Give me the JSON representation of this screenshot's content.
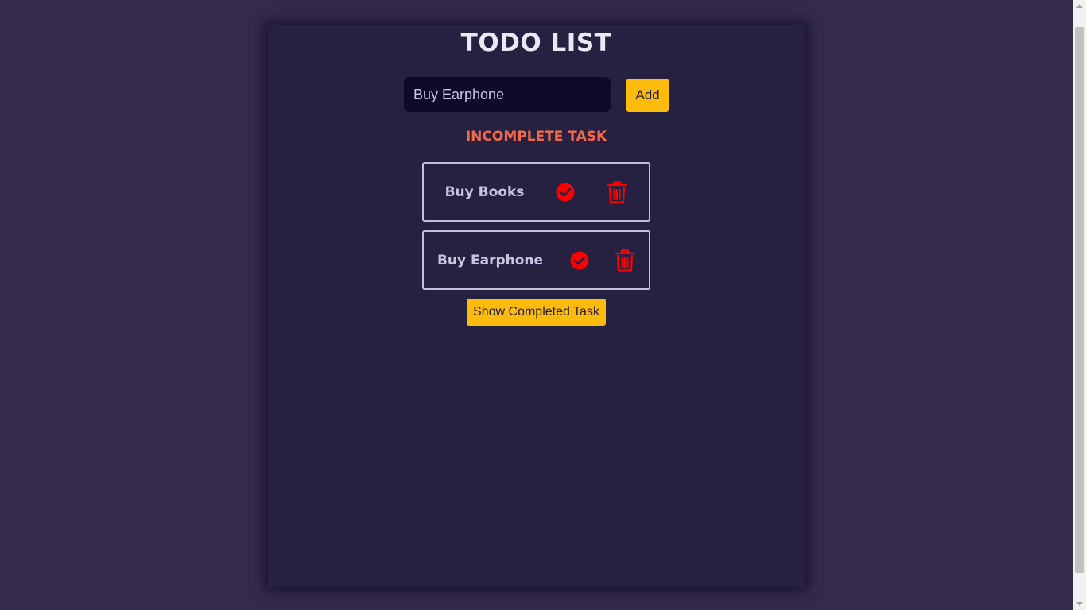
{
  "app": {
    "title": "TODO LIST"
  },
  "input": {
    "value": "Buy Earphone",
    "add_label": "Add"
  },
  "incomplete": {
    "heading": "INCOMPLETE TASK",
    "items": [
      {
        "text": "Buy Books",
        "check_icon": "check-circle-icon",
        "delete_icon": "trash-icon"
      },
      {
        "text": "Buy Earphone",
        "check_icon": "check-circle-icon",
        "delete_icon": "trash-icon"
      }
    ]
  },
  "actions": {
    "show_completed_label": "Show Completed Task"
  },
  "colors": {
    "page_background": "#342a4b",
    "card_background": "#262140",
    "input_background": "#0e0a2a",
    "accent_button": "#fdbb0c",
    "heading_accent": "#f26a4b",
    "icon_red": "#ff0000",
    "task_border": "#c3c0d8"
  }
}
